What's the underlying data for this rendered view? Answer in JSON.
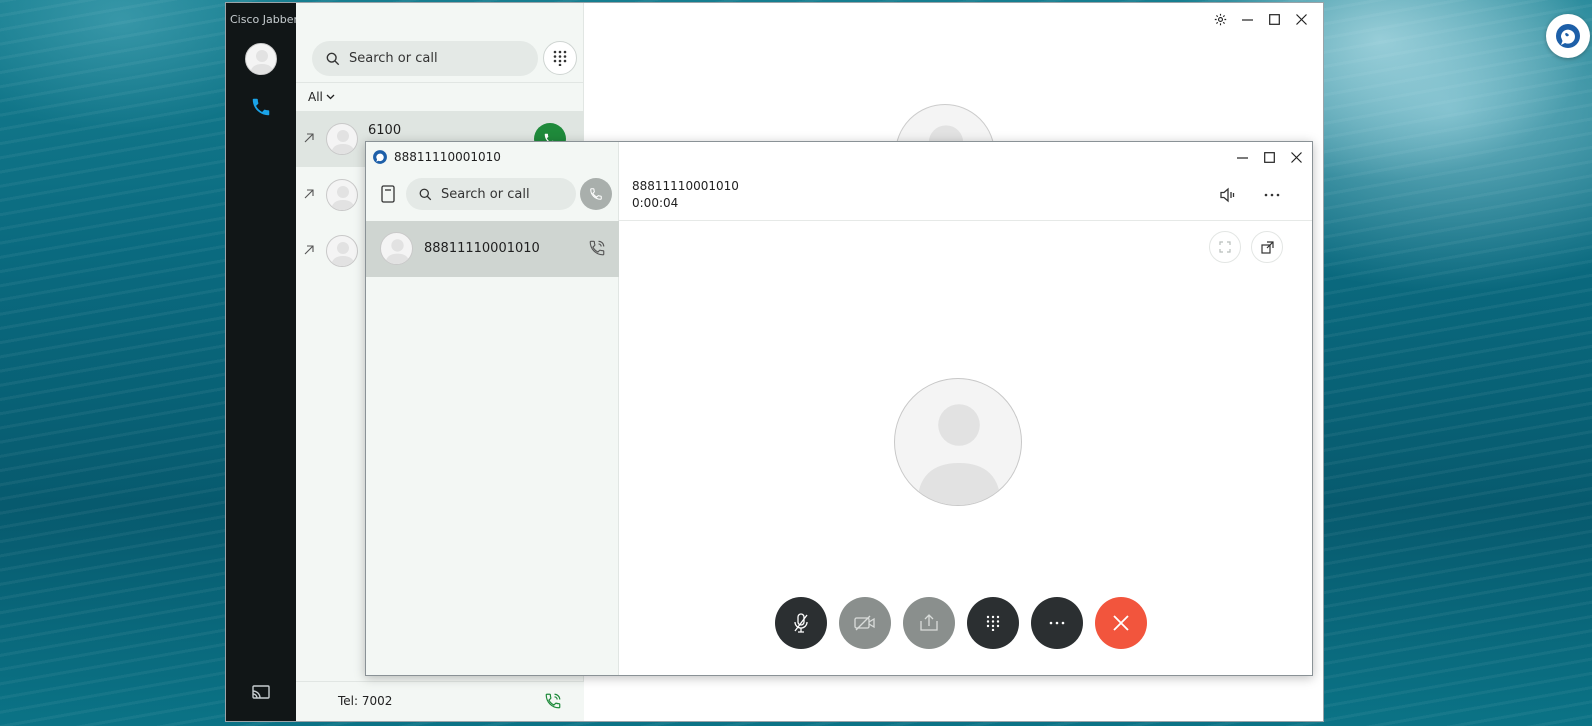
{
  "desktop": {
    "tray_icon": "jabber-tray-icon"
  },
  "main_window": {
    "app_title": "Cisco Jabber",
    "search": {
      "placeholder": "Search or call"
    },
    "filter": {
      "label": "All"
    },
    "recents": [
      {
        "name": "6100",
        "selected": true,
        "has_call_button": true
      },
      {
        "name": "",
        "selected": false,
        "has_call_button": false
      },
      {
        "name": "",
        "selected": false,
        "has_call_button": false
      }
    ],
    "status": {
      "tel": "Tel: 7002"
    },
    "controls": [
      "gear-icon",
      "minimize-icon",
      "maximize-icon",
      "close-icon"
    ]
  },
  "call_window": {
    "title": "88811110001010",
    "search": {
      "placeholder": "Search or call"
    },
    "active_call": {
      "name": "88811110001010"
    },
    "header": {
      "number": "88811110001010",
      "timer": "0:00:04"
    },
    "controls": [
      {
        "name": "mute-button",
        "icon": "mic-muted-icon",
        "style": "dark"
      },
      {
        "name": "video-button",
        "icon": "video-off-icon",
        "style": "gray"
      },
      {
        "name": "share-button",
        "icon": "share-icon",
        "style": "gray"
      },
      {
        "name": "keypad-button",
        "icon": "keypad-icon",
        "style": "dark"
      },
      {
        "name": "more-button",
        "icon": "more-icon",
        "style": "dark"
      },
      {
        "name": "end-call-button",
        "icon": "end-call-icon",
        "style": "red"
      }
    ]
  },
  "colors": {
    "rail": "#111617",
    "panel": "#f3f7f4",
    "accent_blue": "#1aa3e8",
    "call_green": "#1f8a3b",
    "end_call_red": "#f2553d",
    "control_dark": "#2b2f31",
    "control_gray": "#8a8f8d"
  }
}
